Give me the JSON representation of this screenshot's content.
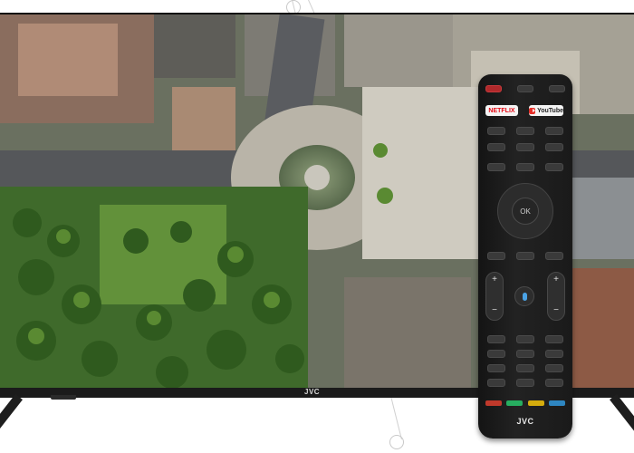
{
  "tv": {
    "brand_logo": "JVC"
  },
  "remote": {
    "brand_logo": "JVC",
    "netflix_label": "NETFLIX",
    "youtube_label": "YouTube",
    "ok_label": "OK",
    "vol_plus": "+",
    "vol_minus": "−",
    "ch_plus": "+",
    "ch_minus": "−"
  },
  "colors": {
    "power": "#b0292b",
    "red_key": "#c0392b",
    "green_key": "#27ae60",
    "yellow_key": "#d4ac0d",
    "blue_key": "#2e86c1"
  },
  "icons": [
    "power-icon",
    "microphone-icon",
    "youtube-play-icon"
  ]
}
